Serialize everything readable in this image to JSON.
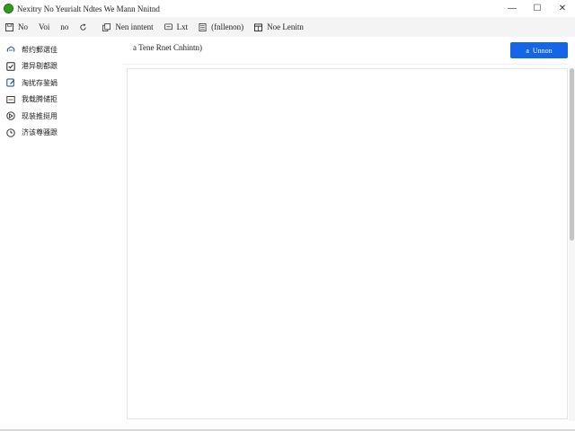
{
  "window": {
    "title": "Nexitry No Yeurialt Ndtes We Mann Nnitnd",
    "controls": {
      "minimize": "—",
      "maximize": "☐",
      "close": "✕"
    },
    "logo_color": "#2f9d1a"
  },
  "toolbar": {
    "items": [
      {
        "label": "No",
        "icon": "save-icon"
      },
      {
        "label": "Voi",
        "icon": null
      },
      {
        "label": "no",
        "icon": null
      },
      {
        "label": "",
        "icon": "refresh-icon"
      },
      {
        "label": "Nen inntent",
        "icon": "copy-icon"
      },
      {
        "label": "Lxt",
        "icon": "comment-icon"
      },
      {
        "label": "(fnllenon)",
        "icon": "document-icon"
      },
      {
        "label": "Noe Lenitn",
        "icon": "calendar-icon"
      }
    ]
  },
  "sidebar": {
    "items": [
      {
        "label": "帮约郵選佳",
        "icon": "cloud-icon"
      },
      {
        "label": "港异剔都跟",
        "icon": "checkbox-icon"
      },
      {
        "label": "淘扰存鉴娟",
        "icon": "edit-icon"
      },
      {
        "label": "我载腾储拒",
        "icon": "panel-icon"
      },
      {
        "label": "现装推挺用",
        "icon": "navigation-icon"
      },
      {
        "label": "济该尊骚跟",
        "icon": "clock-icon"
      }
    ]
  },
  "main": {
    "title": "a Tene Rnet Cnhintn)",
    "primary_button": {
      "label": "Unnon",
      "icon": "a"
    }
  },
  "colors": {
    "accent": "#1565e8",
    "toolbar_bg": "#f4f4f4"
  }
}
